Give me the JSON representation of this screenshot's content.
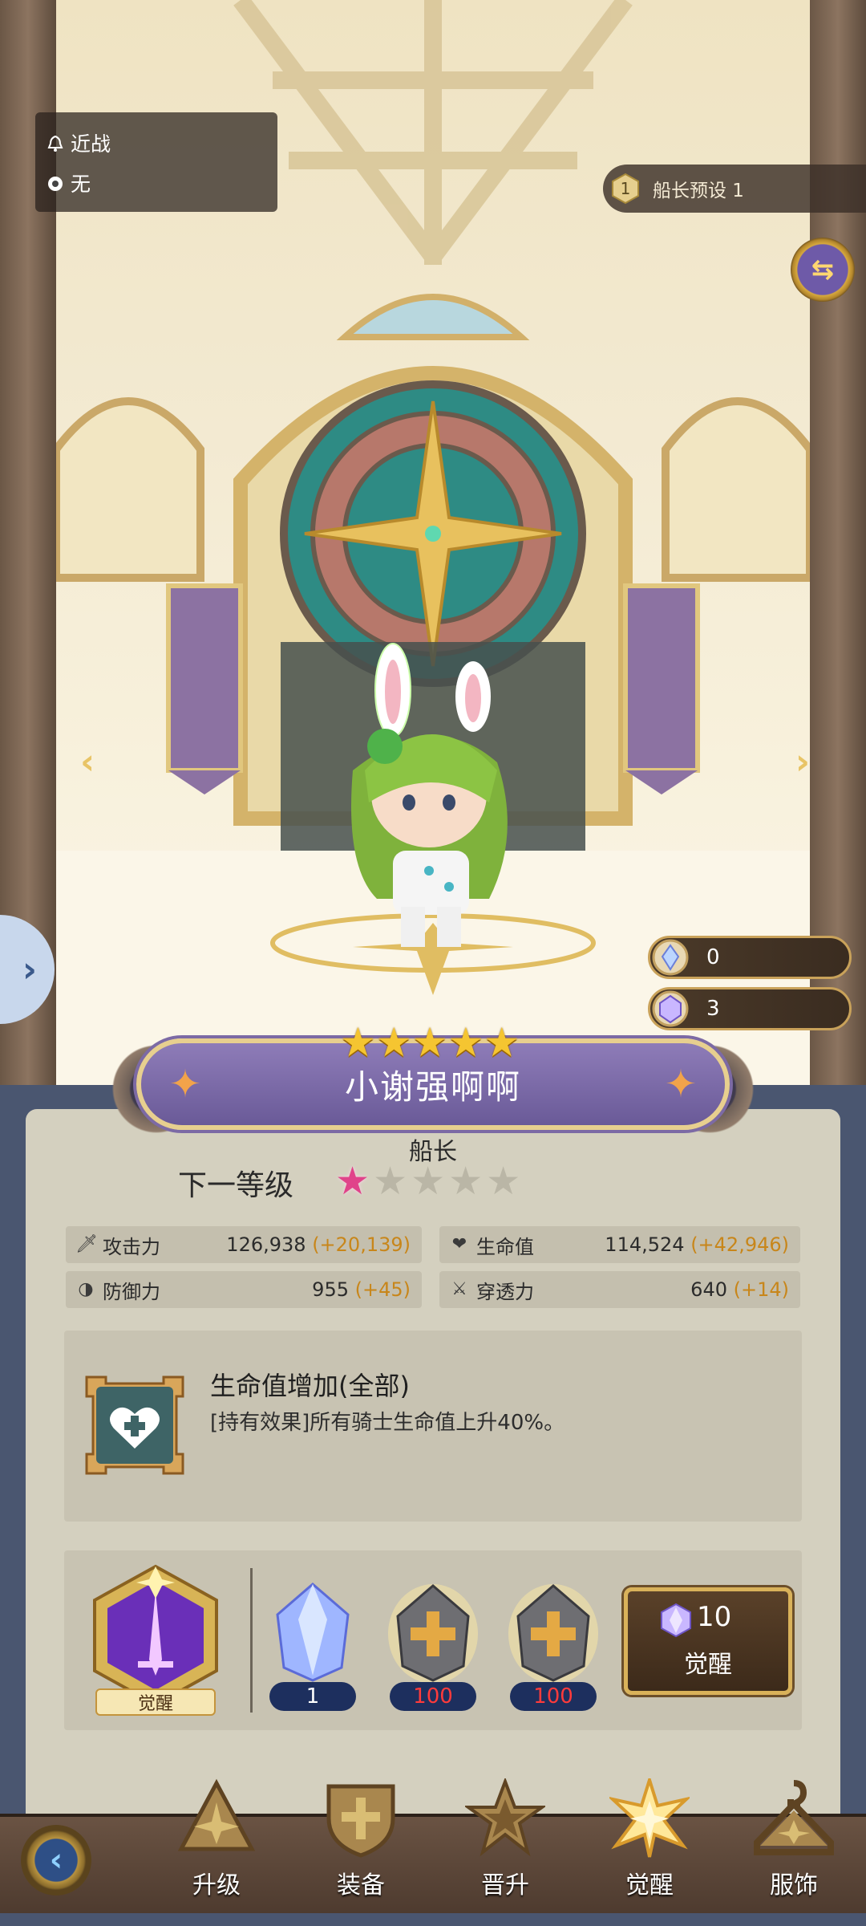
{
  "overlay": {
    "type_label": "近战",
    "element_label": "无"
  },
  "preset": {
    "number": "1",
    "label": "船长预设 1"
  },
  "currency": [
    {
      "icon": "crystal-small-icon",
      "value": "0"
    },
    {
      "icon": "crystal-large-icon",
      "value": "3"
    }
  ],
  "character": {
    "name": "小谢强啊啊",
    "stars": 5,
    "role": "船长"
  },
  "next_level": {
    "label": "下一等级",
    "filled_stars": 1,
    "total_stars": 5
  },
  "stats": [
    {
      "label": "攻击力",
      "value": "126,938",
      "bonus": "(+20,139)",
      "icon": "sword-icon"
    },
    {
      "label": "生命值",
      "value": "114,524",
      "bonus": "(+42,946)",
      "icon": "heart-icon"
    },
    {
      "label": "防御力",
      "value": "955",
      "bonus": "(+45)",
      "icon": "shield-icon"
    },
    {
      "label": "穿透力",
      "value": "640",
      "bonus": "(+14)",
      "icon": "pierce-icon"
    }
  ],
  "effect": {
    "title": "生命值增加(全部)",
    "description": "[持有效果]所有骑士生命值上升40%。"
  },
  "awaken": {
    "badge_label": "觉醒",
    "materials": [
      {
        "icon": "crystal-icon",
        "quantity": "1"
      },
      {
        "icon": "plus-stone-icon",
        "quantity": "100"
      },
      {
        "icon": "plus-stone-icon",
        "quantity": "100"
      }
    ],
    "button_cost": "10",
    "button_label": "觉醒"
  },
  "nav": [
    {
      "label": "升级",
      "icon": "upgrade-icon",
      "active": false
    },
    {
      "label": "装备",
      "icon": "equipment-icon",
      "active": false
    },
    {
      "label": "晋升",
      "icon": "promote-icon",
      "active": false
    },
    {
      "label": "觉醒",
      "icon": "awaken-icon",
      "active": true
    },
    {
      "label": "服饰",
      "icon": "costume-icon",
      "active": false
    }
  ],
  "colors": {
    "bonus": "#c8861a",
    "panel": "#d4d0bf",
    "star_active": "#e0438a",
    "qty_bad": "#ff3b3b"
  }
}
